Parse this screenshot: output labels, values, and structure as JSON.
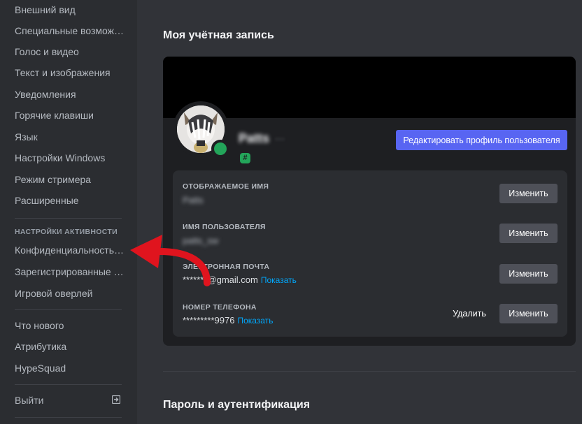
{
  "sidebar": {
    "items_top": [
      {
        "label": "Внешний вид"
      },
      {
        "label": "Специальные возможности"
      },
      {
        "label": "Голос и видео"
      },
      {
        "label": "Текст и изображения"
      },
      {
        "label": "Уведомления"
      },
      {
        "label": "Горячие клавиши"
      },
      {
        "label": "Язык"
      },
      {
        "label": "Настройки Windows"
      },
      {
        "label": "Режим стримера"
      },
      {
        "label": "Расширенные"
      }
    ],
    "activity_header": "НАСТРОЙКИ АКТИВНОСТИ",
    "items_activity": [
      {
        "label": "Конфиденциальность активности"
      },
      {
        "label": "Зарегистрированные игры"
      },
      {
        "label": "Игровой оверлей"
      }
    ],
    "items_bottom": [
      {
        "label": "Что нового"
      },
      {
        "label": "Атрибутика"
      },
      {
        "label": "HypeSquad"
      }
    ],
    "logout_label": "Выйти"
  },
  "account": {
    "title": "Моя учётная запись",
    "display_name": "Patts",
    "username_tag": "···",
    "badge_symbol": "#",
    "edit_profile_label": "Редактировать профиль пользователя",
    "fields": {
      "display_name_label": "ОТОБРАЖАЕМОЕ ИМЯ",
      "display_name_value": "Patts",
      "username_label": "ИМЯ ПОЛЬЗОВАТЕЛЯ",
      "username_value": "patts_sw",
      "email_label": "ЭЛЕКТРОННАЯ ПОЧТА",
      "email_value": "*******@gmail.com",
      "email_reveal": "Показать",
      "phone_label": "НОМЕР ТЕЛЕФОНА",
      "phone_value": "*********9976",
      "phone_reveal": "Показать"
    },
    "change_label": "Изменить",
    "remove_label": "Удалить"
  },
  "password_section": {
    "title": "Пароль и аутентификация"
  },
  "colors": {
    "accent": "#5865f2",
    "online": "#23a55a",
    "link": "#00a8fc",
    "annotation_arrow": "#e0141e"
  }
}
